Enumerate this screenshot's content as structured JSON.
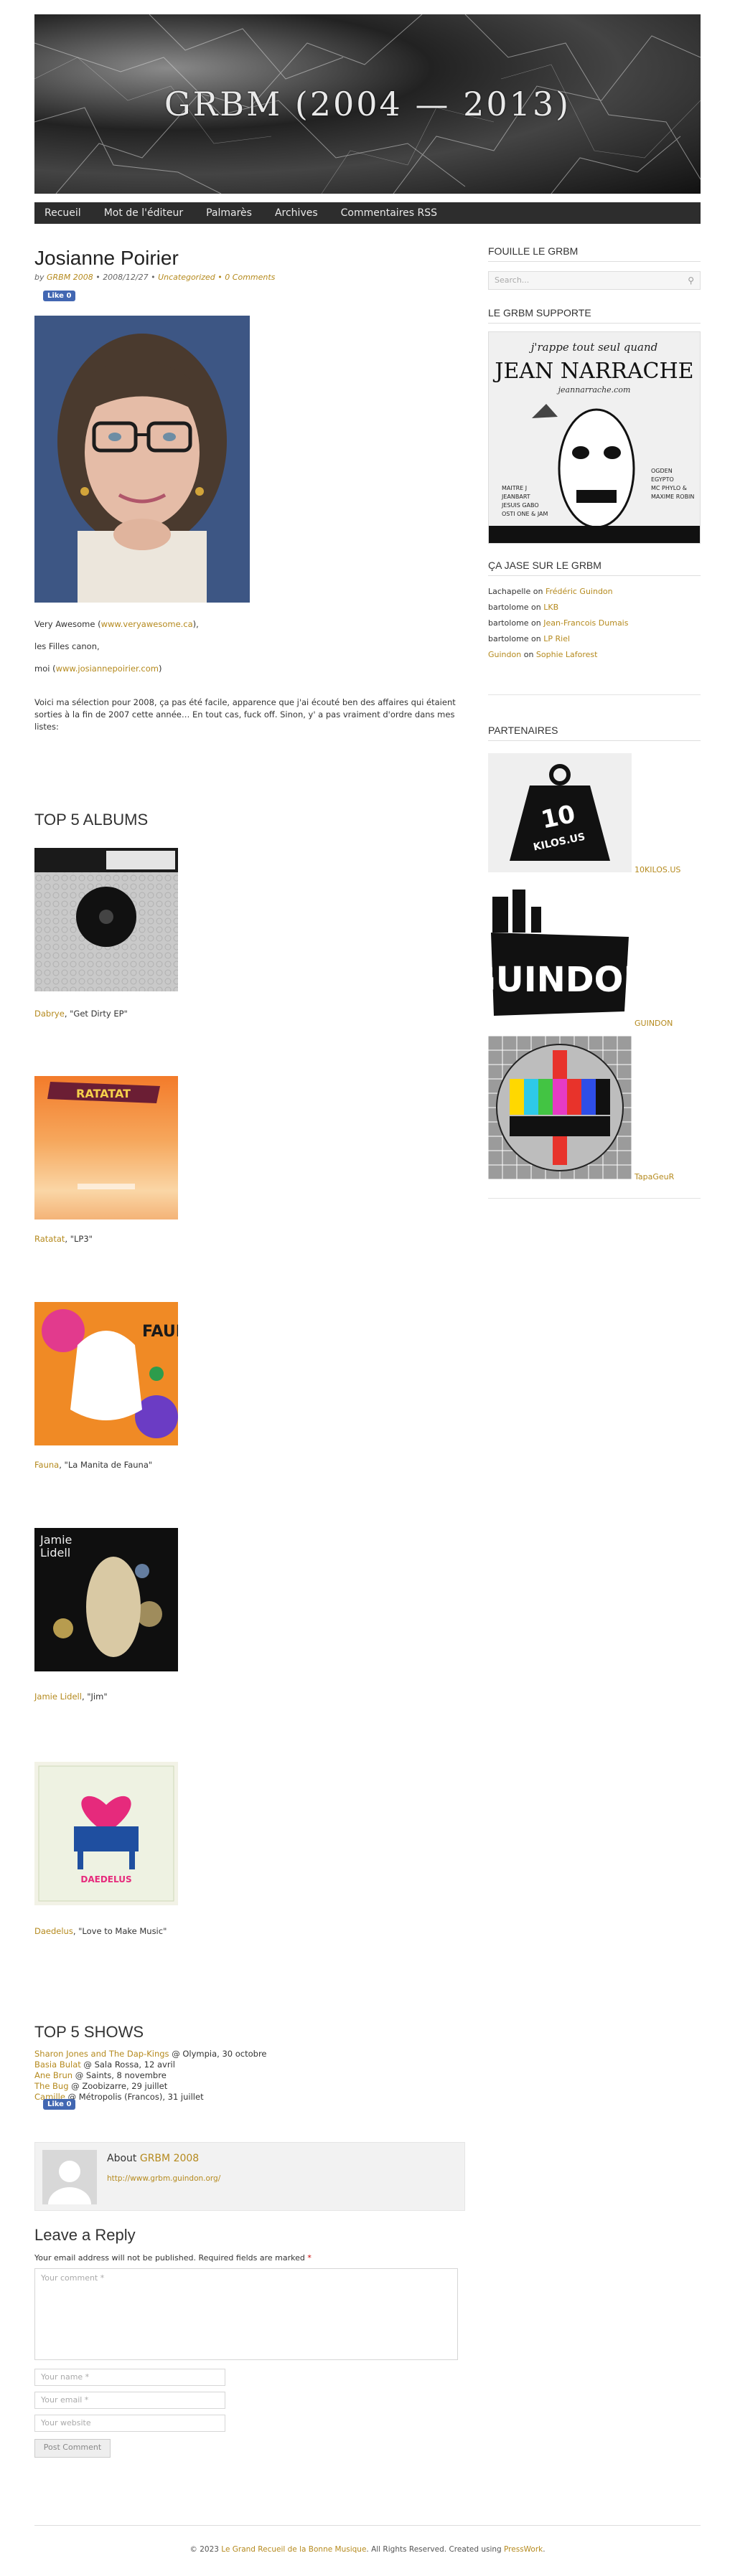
{
  "site": {
    "banner_title": "GRBM (2004 — 2013)",
    "nav": [
      "Recueil",
      "Mot de l'éditeur",
      "Palmarès",
      "Archives",
      "Commentaires RSS"
    ]
  },
  "post": {
    "title": "Josianne Poirier",
    "meta_by": "by",
    "meta_author": "GRBM 2008",
    "meta_date": "• 2008/12/27 •",
    "meta_category": "Uncategorized",
    "meta_comments": "• 0 Comments",
    "like_label": "Like 0",
    "line1_prefix": "Very Awesome (",
    "line1_link": "www.veryawesome.ca",
    "line1_suffix": "),",
    "line2": "les Filles canon,",
    "line3_prefix": "moi (",
    "line3_link": "www.josiannepoirier.com",
    "line3_suffix": ")",
    "intro": "Voici ma sélection pour 2008, ça pas été facile, apparence que j'ai écouté ben des affaires qui étaient sorties à la fin de 2007 cette année… En tout cas, fuck off. Sinon, y' a pas vraiment d'ordre dans mes listes:"
  },
  "albums": {
    "heading": "TOP 5 ALBUMS",
    "items": [
      {
        "artist": "Dabrye",
        "title": ", \"Get Dirty EP\""
      },
      {
        "artist": "Ratatat",
        "title": ", \"LP3\""
      },
      {
        "artist": "Fauna",
        "title": ", \"La Manita de Fauna\""
      },
      {
        "artist": "Jamie Lidell",
        "title": ", \"Jim\""
      },
      {
        "artist": "Daedelus",
        "title": ", \"Love to Make Music\""
      }
    ],
    "cover_texts": {
      "jamie": "Jamie\nLidell",
      "fauna": "FAUNA",
      "ratatat": "RATATAT",
      "daedelus": "DAEDELUS"
    }
  },
  "shows": {
    "heading": "TOP 5 SHOWS",
    "items": [
      {
        "artist": "Sharon Jones and The Dap-Kings",
        "detail": " @ Olympia, 30 octobre"
      },
      {
        "artist": "Basia Bulat",
        "detail": " @ Sala Rossa, 12 avril"
      },
      {
        "artist": "Ane Brun",
        "detail": " @ Saints, 8 novembre"
      },
      {
        "artist": "The Bug",
        "detail": " @ Zoobizarre, 29 juillet"
      },
      {
        "artist": "Camille",
        "detail": " @ Métropolis (Francos), 31 juillet"
      }
    ],
    "like_label": "Like 0"
  },
  "about": {
    "label": "About",
    "author": "GRBM 2008",
    "url": "http://www.grbm.guindon.org/"
  },
  "reply": {
    "heading": "Leave a Reply",
    "notice": "Your email address will not be published. Required fields are marked",
    "required_mark": "*",
    "comment_placeholder": "Your comment *",
    "name_placeholder": "Your name *",
    "email_placeholder": "Your email *",
    "website_placeholder": "Your website",
    "submit": "Post Comment"
  },
  "sidebar": {
    "search_title": "FOUILLE LE GRBM",
    "search_placeholder": "Search...",
    "support_title": "LE GRBM SUPPORTE",
    "support_poster": {
      "top": "j'rappe tout seul quand",
      "name": "JEAN NARRACHE",
      "site": "jeannarrache.com",
      "left": "MAITRE J\nJEANBART\nJESUIS GABO\nOSTI ONE & JAM",
      "right": "OGDEN\nEGYPTO\nMC PHYLO &\nMAXIME ROBIN"
    },
    "jase_title": "ÇA JASE SUR LE GRBM",
    "jase": [
      {
        "who": "Lachapelle",
        "on": " on ",
        "what": "Frédéric Guindon"
      },
      {
        "who": "bartolome",
        "on": " on ",
        "what": "LKB"
      },
      {
        "who": "bartolome",
        "on": " on ",
        "what": "Jean-Francois Dumais"
      },
      {
        "who": "bartolome",
        "on": " on ",
        "what": "LP Riel"
      },
      {
        "who": "Guindon",
        "on": " on ",
        "what": "Sophie Laforest"
      }
    ],
    "partners_title": "PARTENAIRES",
    "partners": [
      {
        "name": "10KILOS.US",
        "logo_text": "10\nKILOS.US"
      },
      {
        "name": "GUINDON",
        "logo_text": "GUINDON"
      },
      {
        "name": "TapaGeuR"
      }
    ]
  },
  "footer": {
    "prefix": "© 2023 ",
    "site": "Le Grand Recueil de la Bonne Musique",
    "middle": ". All Rights Reserved. Created using ",
    "tool": "PressWork",
    "suffix": "."
  },
  "colors": {
    "accent": "#b58a1e",
    "nav_bg": "#2d2d2d"
  }
}
